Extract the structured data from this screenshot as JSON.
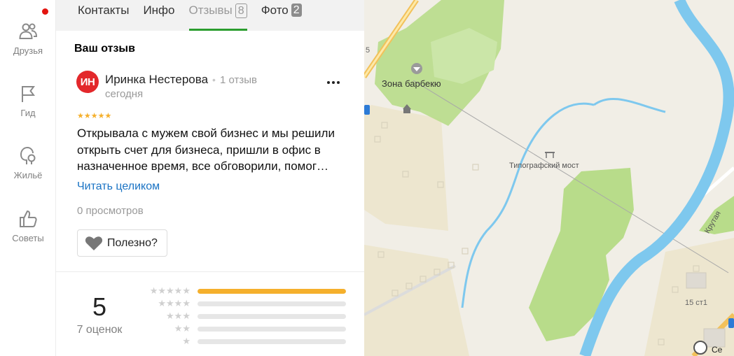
{
  "rail": {
    "items": [
      {
        "label": "Друзья",
        "icon": "friends-icon"
      },
      {
        "label": "Гид",
        "icon": "flag-icon"
      },
      {
        "label": "Жильё",
        "icon": "housing-icon"
      },
      {
        "label": "Советы",
        "icon": "thumbs-up-icon"
      }
    ]
  },
  "tabs": [
    {
      "label": "Контакты"
    },
    {
      "label": "Инфо"
    },
    {
      "label": "Отзывы",
      "badge": "8"
    },
    {
      "label": "Фото",
      "badge": "2"
    }
  ],
  "review": {
    "section_title": "Ваш отзыв",
    "avatar_initials": "ИН",
    "author": "Иринка Нестерова",
    "author_reviews": "1 отзыв",
    "date": "сегодня",
    "rating": 5,
    "stars": "★★★★★",
    "text": "Открывала с мужем свой бизнес и мы решили открыть счет для бизнеса, пришли в офис в назначенное время, все обговорили, помог…",
    "read_more": "Читать целиком",
    "views": "0 просмотров",
    "useful_label": "Полезно?"
  },
  "rating_summary": {
    "score": "5",
    "count_label": "7 оценок",
    "distribution": [
      {
        "stars": "★★★★★",
        "fraction": 1.0
      },
      {
        "stars": "★★★★",
        "fraction": 0.0
      },
      {
        "stars": "★★★",
        "fraction": 0.0
      },
      {
        "stars": "★★",
        "fraction": 0.0
      },
      {
        "stars": "★",
        "fraction": 0.0
      }
    ]
  },
  "map": {
    "labels": {
      "bbq_zone": "Зона барбекю",
      "bridge": "Типографский мост",
      "street": "Крутая",
      "house": "15 ст1",
      "partial_a": "5",
      "partial_b": "Се"
    }
  },
  "colors": {
    "accent_green": "#2b9d2f",
    "star_yellow": "#f5b02c",
    "link_blue": "#1a73c4",
    "avatar_red": "#e3282b",
    "water": "#7ec8ee",
    "park": "#b8dc8a"
  }
}
